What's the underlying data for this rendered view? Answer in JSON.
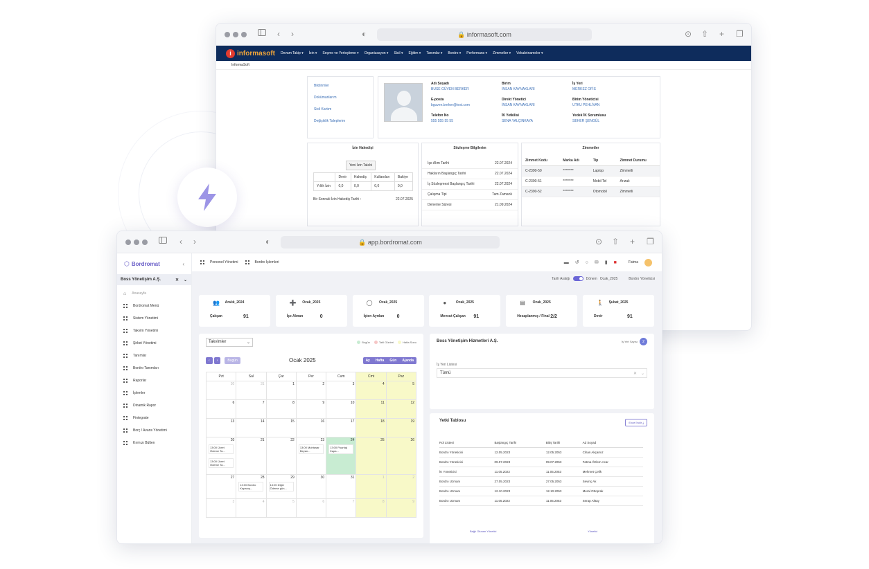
{
  "win1": {
    "url": "informasoft.com",
    "brand": {
      "part1": "informa",
      "part2": "soft"
    },
    "nav": [
      "Devam Takip ▾",
      "İzin ▾",
      "Seçme ve Yerleştirme ▾",
      "Organizasyon ▾",
      "Sicil ▾",
      "Eğitim ▾",
      "Tanımlar ▾",
      "Bordro ▾",
      "Performans ▾",
      "Zimmetler ▾",
      "Vekaletnameler ▾"
    ],
    "breadcrumb": "InformaSoft",
    "links": [
      "Bildirimler",
      "Dokümanlarım",
      "Sicil Kartım",
      "Değişiklik Taleplerim"
    ],
    "profile": [
      {
        "label": "Adı Soyadı",
        "value": "BUSE GÜVEN BERKER"
      },
      {
        "label": "Birim",
        "value": "İNSAN KAYNAKLARI"
      },
      {
        "label": "İş Yeri",
        "value": "MERKEZ OFİS"
      },
      {
        "label": "E-posta",
        "value": "bguven.berker@test.com"
      },
      {
        "label": "Direkt Yönetici",
        "value": "İNSAN KAYNAKLARI"
      },
      {
        "label": "Birim Yöneticisi",
        "value": "UTKU PEHLİVAN"
      },
      {
        "label": "Telefon No",
        "value": "555 555 55 55"
      },
      {
        "label": "İK Yetkilisi",
        "value": "SENA YALÇINKAYA"
      },
      {
        "label": "Yedek İK Sorumlusu",
        "value": "SEHER ŞENGÜL"
      }
    ],
    "leave": {
      "title": "İzin Hakedişi",
      "button": "Yeni İzin Talebi",
      "headers": [
        "",
        "Devir",
        "Hakediş",
        "Kullanılan",
        "Bakiye"
      ],
      "row": [
        "Yıllık İzin",
        "0,0",
        "0,0",
        "0,0",
        "0,0"
      ],
      "next_label": "Bir Sonraki İzin Hakediş Tarihi :",
      "next_value": "22.07.2025"
    },
    "contract": {
      "title": "Sözleşme Bilgilerim",
      "rows": [
        {
          "k": "İşe Alım Tarihi",
          "v": "22.07.2024"
        },
        {
          "k": "Hakların Başlangıç Tarihi",
          "v": "22.07.2024"
        },
        {
          "k": "İş Sözleşmesi Başlangıç Tarihi",
          "v": "22.07.2024"
        },
        {
          "k": "Çalışma Tipi",
          "v": "Tam Zamanlı"
        },
        {
          "k": "Deneme Süresi",
          "v": "21.09.2024"
        }
      ]
    },
    "assets": {
      "title": "Zimmetler",
      "headers": [
        "Zimmet Kodu",
        "Marka Adı",
        "Tip",
        "Zimmet Durumu"
      ],
      "rows": [
        [
          "C-2390-50",
          "********",
          "Laptop",
          "Zimmetli"
        ],
        [
          "C-2390-51",
          "********",
          "Mobil Tel",
          "Arızalı"
        ],
        [
          "C-2390-52",
          "********",
          "Otomobil",
          "Zimmetli"
        ]
      ]
    }
  },
  "win2": {
    "url": "app.bordromat.com",
    "brand": "Bordromat",
    "company": "Boss Yönetişim A.Ş.",
    "sidebar": [
      "Anasayfa",
      "Bordromat Menü",
      "Sistem Yönetimi",
      "Takvim Yönetimi",
      "Şirket Yönetimi",
      "Tanımlar",
      "Bordro Tanımları",
      "Raporlar",
      "İşlemler",
      "Dinamik Rapor",
      "Fintegrate",
      "Borç / Avans Yönetimi",
      "Kırmızı Bülten"
    ],
    "topbar_tabs": [
      "Personel Yönetimi",
      "Bordro İşlemleri"
    ],
    "user": "Fatma",
    "subbar": {
      "left": "Tarih Aralığı",
      "period_label": "Dönem",
      "period": "Ocak_2025",
      "role": "Bordro Yöneticisi"
    },
    "stats": [
      {
        "period": "Aralık_2024",
        "label": "Çalışan",
        "value": "91",
        "icon": "users-icon"
      },
      {
        "period": "Ocak_2025",
        "label": "İşe Alınan",
        "value": "0",
        "icon": "user-plus-icon"
      },
      {
        "period": "Ocak_2025",
        "label": "İşten Ayrılan",
        "value": "0",
        "icon": "user-minus-icon"
      },
      {
        "period": "Ocak_2025",
        "label": "Mevcut Çalışan",
        "value": "91",
        "icon": "user-icon"
      },
      {
        "period": "Ocak_2025",
        "label": "Hesaplanmış / Final",
        "value": "2/2",
        "icon": "clipboard-icon"
      },
      {
        "period": "Şubat_2025",
        "label": "Devir",
        "value": "91",
        "icon": "walk-icon"
      }
    ],
    "calendar": {
      "select": "Takvimler",
      "legend": [
        "Bugün",
        "Tatil Günleri",
        "Hafta Sonu"
      ],
      "today_btn": "Bugün",
      "month": "Ocak 2025",
      "views": [
        "Ay",
        "Hafta",
        "Gün",
        "Ajanda"
      ],
      "days": [
        "Pzt",
        "Sal",
        "Çar",
        "Per",
        "Cum",
        "Cmt",
        "Paz"
      ],
      "weeks": [
        [
          "30",
          "31",
          "1",
          "2",
          "3",
          "4",
          "5"
        ],
        [
          "6",
          "7",
          "8",
          "9",
          "10",
          "11",
          "12"
        ],
        [
          "13",
          "14",
          "15",
          "16",
          "17",
          "18",
          "19"
        ],
        [
          "20",
          "21",
          "22",
          "23",
          "24",
          "25",
          "26"
        ],
        [
          "27",
          "28",
          "29",
          "30",
          "31",
          "1",
          "2"
        ],
        [
          "3",
          "4",
          "5",
          "6",
          "7",
          "8",
          "9"
        ]
      ],
      "events": {
        "e1": "13:00 Ücret Ödeme Ta...",
        "e2": "13:00 Ücret Ödeme Ta...",
        "e3": "13:00 Muhtasar Beyan...",
        "e4": "13:00 Puantaj Kapa...",
        "e5": "13:00 Bordro Kapanış...",
        "e6": "13:00 Diğer Ödeme gün..."
      }
    },
    "company_card": {
      "title": "Boss Yönetişim Hizmetleri A.Ş.",
      "link": "İş Yeri Sayısı",
      "count": "2",
      "list_label": "İş Yeri Listesi",
      "selected": "Tümü"
    },
    "auth": {
      "title": "Yetki Tablosu",
      "export": "Excel İndir",
      "headers": [
        "Rol Listesi",
        "Başlangıç Tarihi",
        "Bitiş Tarihi",
        "Ad Soyad"
      ],
      "rows": [
        [
          "Bordro Yöneticisi",
          "12.05.2023",
          "12.05.2053",
          "Cihan Akçamız"
        ],
        [
          "Bordro Yöneticisi",
          "09.07.2023",
          "09.07.2053",
          "Fatma Özlem Acar"
        ],
        [
          "İK Yöneticisi",
          "11.05.2023",
          "11.05.2053",
          "Mehmet Çelik"
        ],
        [
          "Bordro Uzmanı",
          "27.05.2023",
          "27.05.2053",
          "Sevinç Ak"
        ],
        [
          "Bordro Uzmanı",
          "12.10.2023",
          "12.10.2053",
          "Meral Ottoprak"
        ],
        [
          "Bordro Uzmanı",
          "11.05.2023",
          "11.05.2053",
          "Serap Aktay"
        ]
      ],
      "footer": [
        "Bağlı Olunan Yönetici",
        "Yönetici"
      ]
    }
  },
  "colors": {
    "navy": "#0e2c5c",
    "purple": "#7f78d0",
    "yellow": "#f8f9c8",
    "green": "#c8ecd2"
  }
}
